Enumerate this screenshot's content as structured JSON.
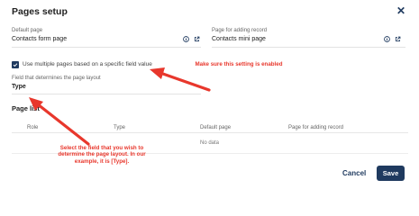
{
  "dialog": {
    "title": "Pages setup",
    "close_icon": "close-icon"
  },
  "default_page": {
    "label": "Default page",
    "value": "Contacts form page"
  },
  "adding_page": {
    "label": "Page for adding record",
    "value": "Contacts mini page"
  },
  "icons": {
    "info": "info-icon",
    "open": "open-external-icon"
  },
  "checkbox": {
    "checked": true,
    "label": "Use multiple pages based on a specific field value"
  },
  "layout_field": {
    "label": "Field that determines the page layout",
    "value": "Type"
  },
  "page_list": {
    "title": "Page list",
    "columns": [
      "Role",
      "Type",
      "Default page",
      "Page for adding record"
    ],
    "empty_text": "No data"
  },
  "buttons": {
    "cancel": "Cancel",
    "save": "Save"
  },
  "annotations": {
    "top": "Make sure this setting is enabled",
    "bottom": "Select the field that you wish to determine the page layout. In our example, it is [Type]."
  },
  "colors": {
    "accent": "#1f3a5f",
    "annotation": "#e8372c"
  }
}
